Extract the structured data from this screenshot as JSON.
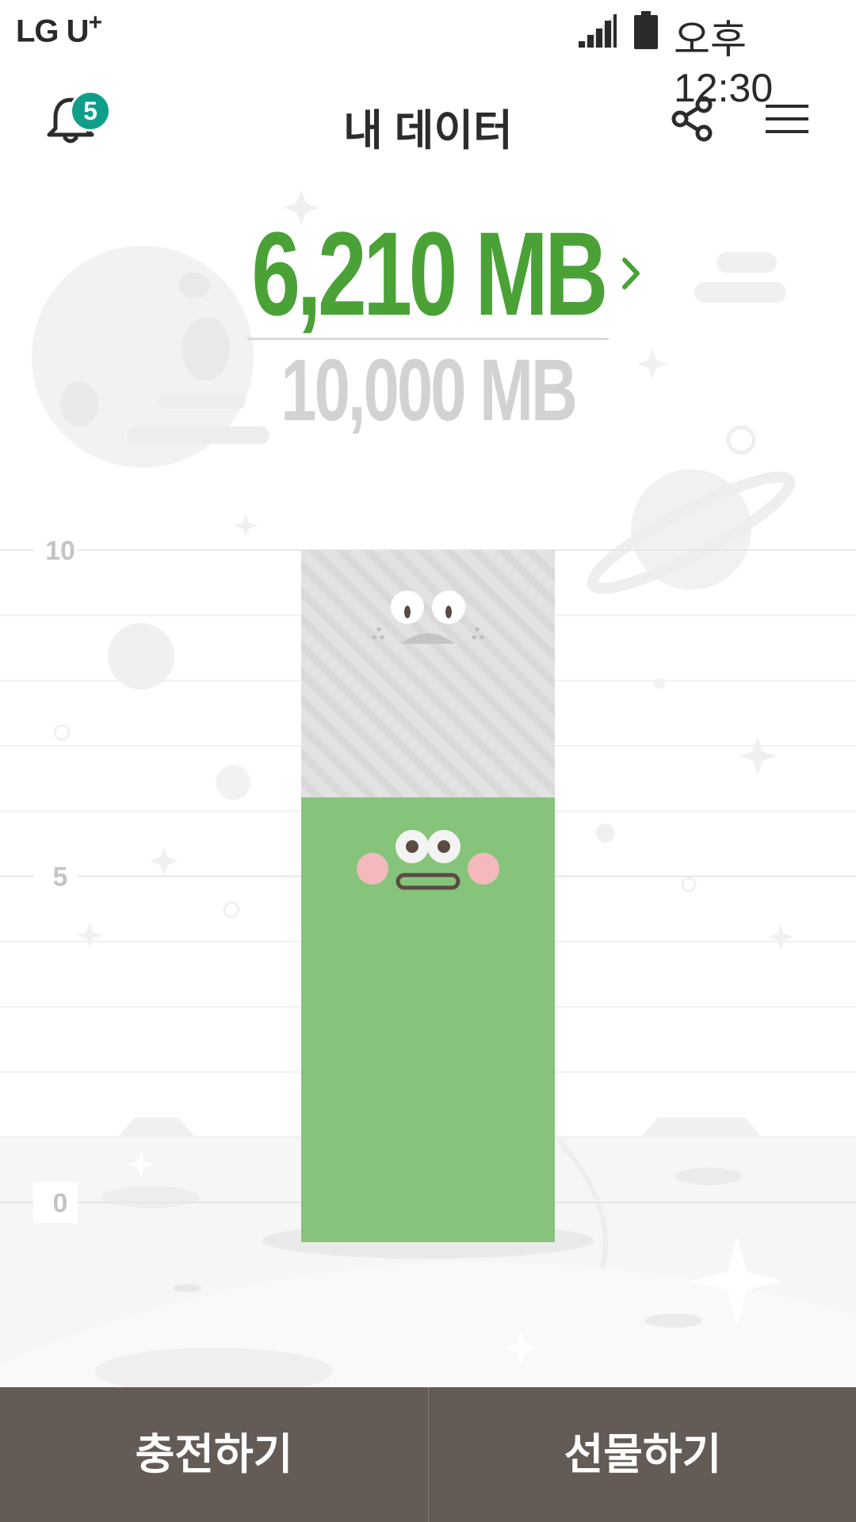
{
  "status_bar": {
    "carrier": "LG U",
    "carrier_plus": "+",
    "time": "오후 12:30"
  },
  "header": {
    "title": "내 데이터",
    "notification_count": "5",
    "icons": [
      "bell-icon",
      "share-icon",
      "menu-icon"
    ]
  },
  "data": {
    "used": "6,210",
    "used_unit": "MB",
    "total": "10,000",
    "total_unit": "MB"
  },
  "chart_data": {
    "type": "bar",
    "categories": [
      ""
    ],
    "values": [
      6.21
    ],
    "capacity": 10,
    "ylim": [
      0,
      10
    ],
    "y_ticks": [
      "0",
      "5",
      "10"
    ],
    "grid": true
  },
  "actions": {
    "charge_label": "충전하기",
    "gift_label": "선물하기"
  },
  "colors": {
    "accent": "#4aa237",
    "bar_fill": "#86c47b",
    "bar_empty": "#e2e2e2",
    "badge": "#109e8a",
    "bottom_bar": "#645b56"
  }
}
